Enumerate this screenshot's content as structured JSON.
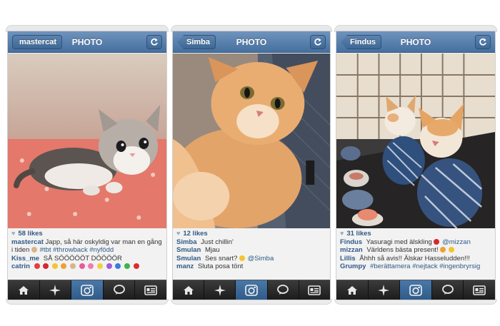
{
  "phones": [
    {
      "back_label": "mastercat",
      "title": "PHOTO",
      "likes": "58 likes",
      "comments": [
        {
          "user": "mastercat",
          "text": "Japp, så här oskyldig var man en gång i tiden",
          "tags": "#tbt #throwback #nyfödd"
        },
        {
          "user": "Kiss_me",
          "text": "SÅ SÖÖÖÖÖT DÖÖÖÖR"
        },
        {
          "user": "catrin",
          "text": ""
        }
      ]
    },
    {
      "back_label": "Simba",
      "title": "PHOTO",
      "likes": "12 likes",
      "comments": [
        {
          "user": "Simba",
          "text": "Just chillin'"
        },
        {
          "user": "Smulan",
          "text": "Mjau"
        },
        {
          "user": "Smulan",
          "text": "Ses snart?",
          "tags": "@Simba"
        },
        {
          "user": "manz",
          "text": "Sluta posa tönt"
        }
      ]
    },
    {
      "back_label": "Findus",
      "title": "PHOTO",
      "likes": "31 likes",
      "comments": [
        {
          "user": "Findus",
          "text": "Yasuragi med älskling",
          "tags": "@mizzan"
        },
        {
          "user": "mizzan",
          "text": "Världens bästa present!"
        },
        {
          "user": "Lillis",
          "text": "Åhhh så avis!! Älskar Hasseludden!!!"
        },
        {
          "user": "Grumpy",
          "text": "",
          "tags": "#berättamera #nejtack #ingenbryrsig"
        }
      ]
    }
  ],
  "tabs": [
    "home-icon",
    "explore-icon",
    "camera-icon",
    "news-icon",
    "profile-icon"
  ],
  "active_tab": 2,
  "colors": {
    "header": "#46709f",
    "username": "#305a87",
    "tabbar": "#1c1c1c",
    "active_tab": "#2f5b88"
  }
}
